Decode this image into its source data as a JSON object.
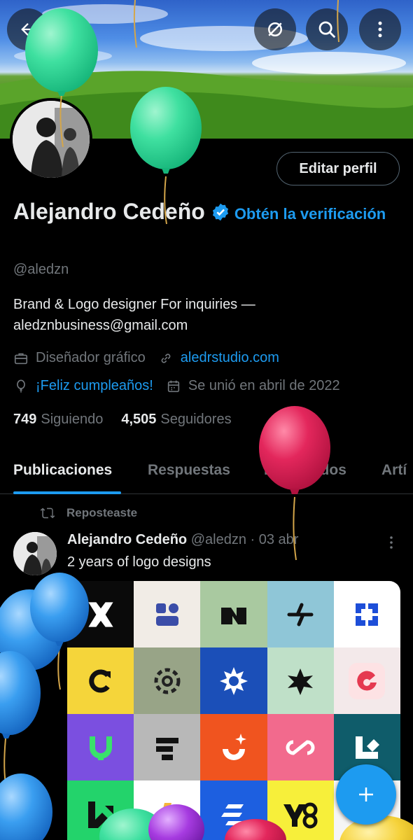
{
  "header": {
    "back_icon": "arrow-left-icon",
    "actions": [
      "hide-icon",
      "search-icon",
      "more-vertical-icon"
    ]
  },
  "profile": {
    "edit_label": "Editar perfil",
    "name": "Alejandro Cedeño",
    "get_verified": "Obtén la verificación",
    "handle": "@aledzn",
    "bio": "Brand & Logo designer  For inquiries — aledznbusiness@gmail.com",
    "category": "Diseñador gráfico",
    "website": "aledrstudio.com",
    "birthday": "¡Feliz cumpleaños!",
    "joined": "Se unió en abril de 2022",
    "following_count": "749",
    "following_label": "Siguiendo",
    "followers_count": "4,505",
    "followers_label": "Seguidores"
  },
  "tabs": [
    "Publicaciones",
    "Respuestas",
    "Destacados",
    "Artí"
  ],
  "post": {
    "repost_label": "Reposteaste",
    "author": "Alejandro Cedeño",
    "handle": "@aledzn",
    "date": "· 03 abr",
    "text": "2 years of logo designs"
  },
  "colors": {
    "accent": "#1d9bf0",
    "background": "#000000",
    "muted": "#71767b"
  }
}
